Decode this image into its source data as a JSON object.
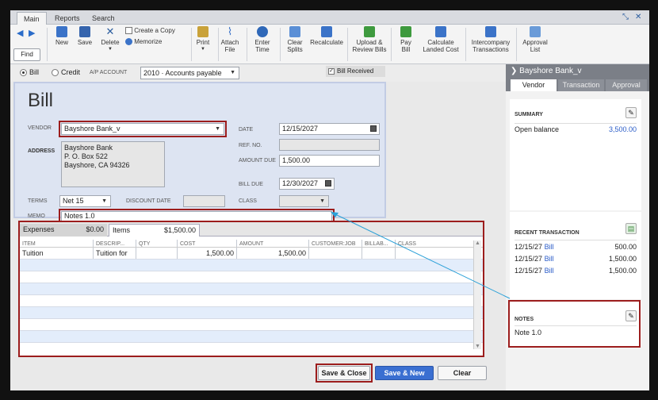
{
  "tabs": [
    "Main",
    "Reports",
    "Search"
  ],
  "toolbar": {
    "find": "Find",
    "new": "New",
    "save": "Save",
    "delete": "Delete",
    "create_copy": "Create a Copy",
    "memorize": "Memorize",
    "print": "Print",
    "attach_file": [
      "Attach",
      "File"
    ],
    "enter_time": [
      "Enter",
      "Time"
    ],
    "clear_splits": [
      "Clear",
      "Splits"
    ],
    "recalculate": "Recalculate",
    "upload_review": [
      "Upload &",
      "Review Bills"
    ],
    "pay_bill": [
      "Pay",
      "Bill"
    ],
    "landed_cost": [
      "Calculate",
      "Landed Cost"
    ],
    "intercompany": [
      "Intercompany",
      "Transactions"
    ],
    "approval_list": [
      "Approval",
      "List"
    ]
  },
  "options": {
    "bill": "Bill",
    "credit": "Credit",
    "ap_label": "A/P ACCOUNT",
    "ap_value": "2010 · Accounts payable",
    "bill_received": "Bill Received"
  },
  "bill": {
    "title": "Bill",
    "vendor_label": "VENDOR",
    "vendor": "Bayshore Bank_v",
    "address_label": "ADDRESS",
    "address": [
      "Bayshore Bank",
      "P. O. Box 522",
      "Bayshore, CA 94326"
    ],
    "date_label": "DATE",
    "date": "12/15/2027",
    "ref_label": "REF. NO.",
    "ref": "",
    "amount_label": "AMOUNT DUE",
    "amount": "1,500.00",
    "bill_due_label": "BILL DUE",
    "bill_due": "12/30/2027",
    "terms_label": "TERMS",
    "terms": "Net 15",
    "discount_label": "DISCOUNT DATE",
    "class_label": "CLASS",
    "memo_label": "MEMO",
    "memo": "Notes 1.0"
  },
  "lines": {
    "expenses_tab": "Expenses",
    "expenses_total": "$0.00",
    "items_tab": "Items",
    "items_total": "$1,500.00",
    "columns": [
      "ITEM",
      "DESCRIP...",
      "QTY",
      "COST",
      "AMOUNT",
      "CUSTOMER:JOB",
      "BILLAB...",
      "CLASS"
    ],
    "rows": [
      [
        "Tuition",
        "Tuition for",
        "",
        "1,500.00",
        "1,500.00",
        "",
        "",
        ""
      ]
    ]
  },
  "buttons": {
    "save_close": "Save & Close",
    "save_new": "Save & New",
    "clear": "Clear"
  },
  "panel": {
    "vendor_name": "Bayshore Bank_v",
    "tabs": [
      "Vendor",
      "Transaction",
      "Approval"
    ],
    "summary_title": "SUMMARY",
    "open_balance_label": "Open balance",
    "open_balance": "3,500.00",
    "recent_title": "RECENT TRANSACTION",
    "recent": [
      {
        "date": "12/15/27",
        "type": "Bill",
        "amount": "500.00"
      },
      {
        "date": "12/15/27",
        "type": "Bill",
        "amount": "1,500.00"
      },
      {
        "date": "12/15/27",
        "type": "Bill",
        "amount": "1,500.00"
      }
    ],
    "notes_title": "NOTES",
    "notes": "Note 1.0"
  },
  "colors": {
    "accent": "#2a5cc8",
    "highlight_border": "#9c1d1d",
    "save_new": "#3a6fd1"
  }
}
